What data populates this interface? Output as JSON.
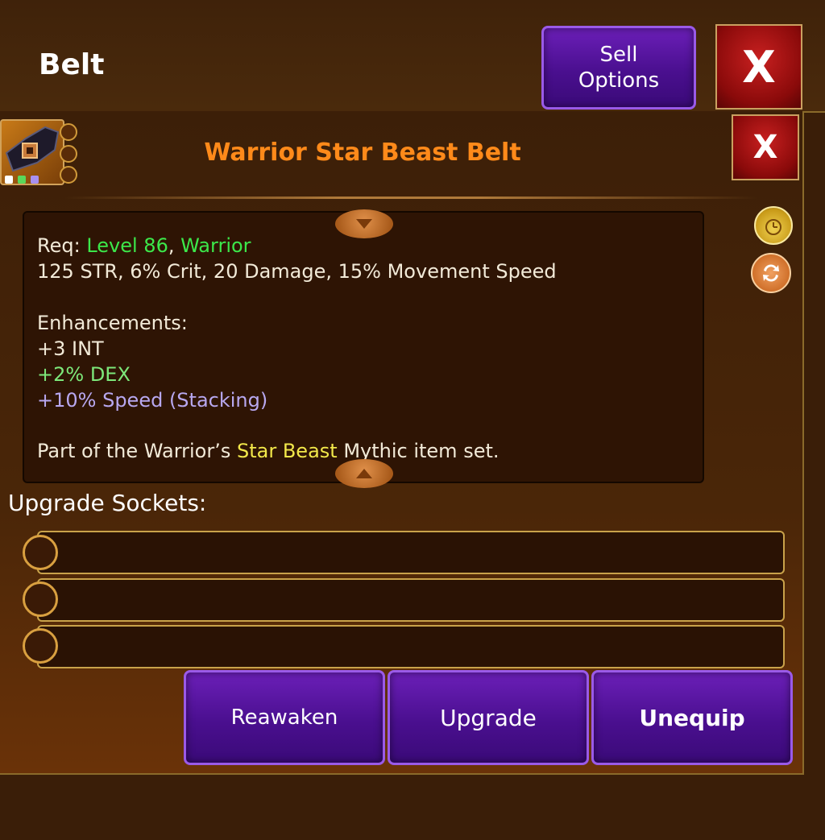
{
  "header": {
    "title": "Belt",
    "sell_options_label": "Sell\nOptions",
    "close_label": "X"
  },
  "item": {
    "name": "Warrior Star Beast Belt",
    "close_label": "X",
    "requirements": {
      "prefix": "Req: ",
      "level": "Level 86",
      "separator": ", ",
      "class": "Warrior"
    },
    "stats": "125 STR, 6% Crit, 20 Damage, 15% Movement Speed",
    "enhancements_header": "Enhancements:",
    "enhancements": [
      {
        "text": "+3 INT",
        "color": "#f2ead8"
      },
      {
        "text": "+2% DEX",
        "color": "#7de87a"
      },
      {
        "text": "+10% Speed (Stacking)",
        "color": "#b8a8f0"
      }
    ],
    "set_text": {
      "before": "Part of the Warrior’s ",
      "set_name": "Star Beast",
      "after": " Mythic item set."
    },
    "gem_colors": [
      "#ffffff",
      "#5ad85a",
      "#a890f0"
    ]
  },
  "sockets": {
    "label": "Upgrade Sockets:",
    "count": 3
  },
  "actions": {
    "reawaken": "Reawaken",
    "upgrade": "Upgrade",
    "unequip": "Unequip"
  },
  "side_icons": [
    "gold-bag-icon",
    "swap-icon"
  ]
}
